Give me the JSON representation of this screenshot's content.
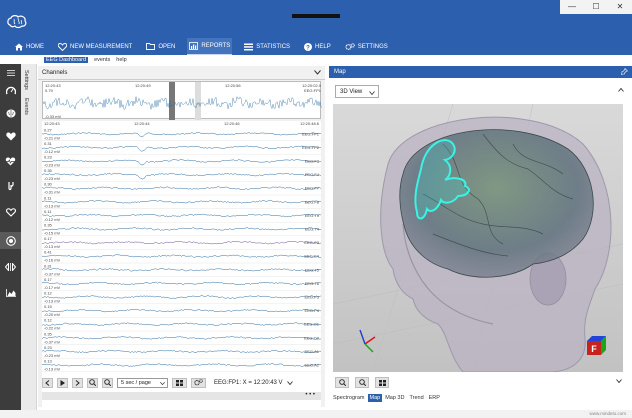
{
  "window": {
    "minimize": "—",
    "maximize": "☐",
    "close": "✕"
  },
  "menu": [
    {
      "id": "home",
      "label": "HOME",
      "icon": "home-icon"
    },
    {
      "id": "new-measurement",
      "label": "NEW MEASUREMENT",
      "icon": "heart-icon"
    },
    {
      "id": "open",
      "label": "OPEN",
      "icon": "folder-icon"
    },
    {
      "id": "reports",
      "label": "REPORTS",
      "icon": "chart-icon",
      "active": true
    },
    {
      "id": "statistics",
      "label": "STATISTICS",
      "icon": "list-icon"
    },
    {
      "id": "help",
      "label": "HELP",
      "icon": "question-icon"
    },
    {
      "id": "settings",
      "label": "SETTINGS",
      "icon": "gears-icon"
    }
  ],
  "subtabs": [
    {
      "label": "EEG Dashboard",
      "active": true
    },
    {
      "label": "events"
    },
    {
      "label": "help"
    }
  ],
  "sidebar_icons": [
    "menu-icon",
    "gauge-icon",
    "brain-icon",
    "heart-icon",
    "heart-rate-icon",
    "gsr-icon",
    "heart-outline-icon",
    "eye-icon",
    "split-icon",
    "bar-chart-icon"
  ],
  "vtabs": {
    "settings": "Settings",
    "events": "Events"
  },
  "channels_panel": {
    "title": "Channels",
    "overview": {
      "start": "12:20:43",
      "t1": "12:20:49",
      "t2": "12:20:56",
      "end": "12:20:02.0",
      "chan": "EEG:FP1",
      "top_val": "0.79",
      "bottom_val": "-0.33 mV"
    },
    "eeg_times": [
      "12:20:43",
      "12:20:44",
      "12:20:46",
      "12:20:48.6"
    ],
    "channels": [
      {
        "name": "EEG:FP1",
        "scale": "0.27",
        "unit": "-0.21 mV"
      },
      {
        "name": "EEG:FP2",
        "scale": "0.31",
        "unit": "-0.12 mV"
      },
      {
        "name": "EEG:F3",
        "scale": "0.23",
        "unit": "-0.23 mV"
      },
      {
        "name": "EEG:F4",
        "scale": "0.35",
        "unit": "-0.23 mV"
      },
      {
        "name": "EEG:F7",
        "scale": "0.30",
        "unit": "-0.31 mV"
      },
      {
        "name": "EEG:F8",
        "scale": "0.11",
        "unit": "-0.13 mV"
      },
      {
        "name": "EEG:T3",
        "scale": "0.11",
        "unit": "-0.12 mV"
      },
      {
        "name": "EEG:T4",
        "scale": "0.35",
        "unit": "-0.15 mV"
      },
      {
        "name": "EEG:C3",
        "scale": "0.17",
        "unit": "-0.13 mV"
      },
      {
        "name": "EEG:C4",
        "scale": "0.41",
        "unit": "-0.16 mV"
      },
      {
        "name": "EEG:T5",
        "scale": "0.31",
        "unit": "-0.37 mV"
      },
      {
        "name": "EEG:T6",
        "scale": "0.17",
        "unit": "-0.17 mV"
      },
      {
        "name": "EEG:P3",
        "scale": "0.12",
        "unit": "-0.13 mV"
      },
      {
        "name": "EEG:P4",
        "scale": "0.15",
        "unit": "-0.20 mV"
      },
      {
        "name": "EEG:O1",
        "scale": "0.12",
        "unit": "-0.22 mV"
      },
      {
        "name": "EEG:O2",
        "scale": "0.35",
        "unit": "-0.37 mV"
      },
      {
        "name": "EEG:A1",
        "scale": "0.23",
        "unit": "-0.23 mV"
      },
      {
        "name": "EEG:A2",
        "scale": "0.13",
        "unit": "-0.13 mV"
      }
    ],
    "page_select": "5 sec / page",
    "cursor_readout": "EEG:FP1:   X = 12:20:43  V",
    "more": "• • •"
  },
  "map_panel": {
    "title": "Map",
    "view_select": "3D View",
    "orientation_letter": "F",
    "tabs": [
      {
        "label": "Spectrogram"
      },
      {
        "label": "Map",
        "active": true
      },
      {
        "label": "Map 3D"
      },
      {
        "label": "Trend"
      },
      {
        "label": "ERP"
      }
    ]
  },
  "status": "www.mindeto.com",
  "colors": {
    "brand": "#2c5fad",
    "trace": "#2d6ea3",
    "trace_alt": "#6e4f96",
    "highlight": "#3cf2e4"
  }
}
